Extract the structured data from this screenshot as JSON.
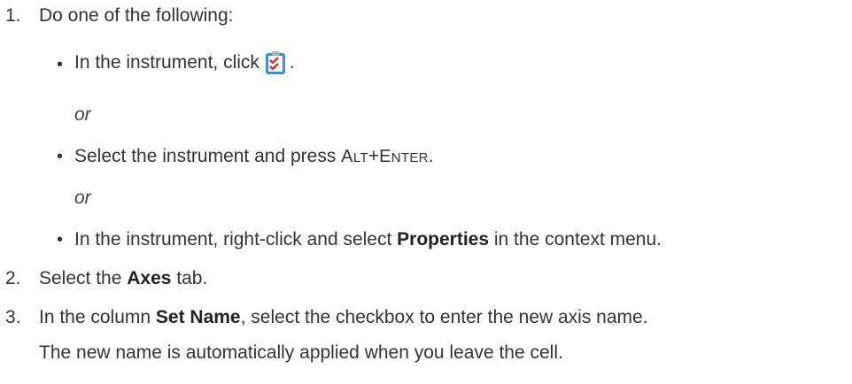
{
  "steps": [
    {
      "number": "1.",
      "text": "Do one of the following:"
    },
    {
      "number": "2.",
      "pre": "Select the ",
      "bold": "Axes",
      "post": " tab."
    },
    {
      "number": "3.",
      "pre": "In the column ",
      "bold": "Set Name",
      "post": ", select the checkbox to enter the new axis name.",
      "note": "The new name is automatically applied when you leave the cell."
    }
  ],
  "options": [
    {
      "pre": "In the instrument, click",
      "icon": "properties-checklist-icon",
      "post": "."
    },
    {
      "pre": "Select the instrument and press ",
      "key1_cap": "A",
      "key1_rest": "LT",
      "plus": "+",
      "key2_cap": "E",
      "key2_rest": "NTER",
      "post": "."
    },
    {
      "pre": "In the instrument, right-click and select ",
      "bold": "Properties",
      "post": " in the context menu."
    }
  ],
  "separator": "or",
  "colors": {
    "text": "#333333",
    "icon_blue": "#3a8fd8",
    "icon_check": "#d0342c"
  }
}
